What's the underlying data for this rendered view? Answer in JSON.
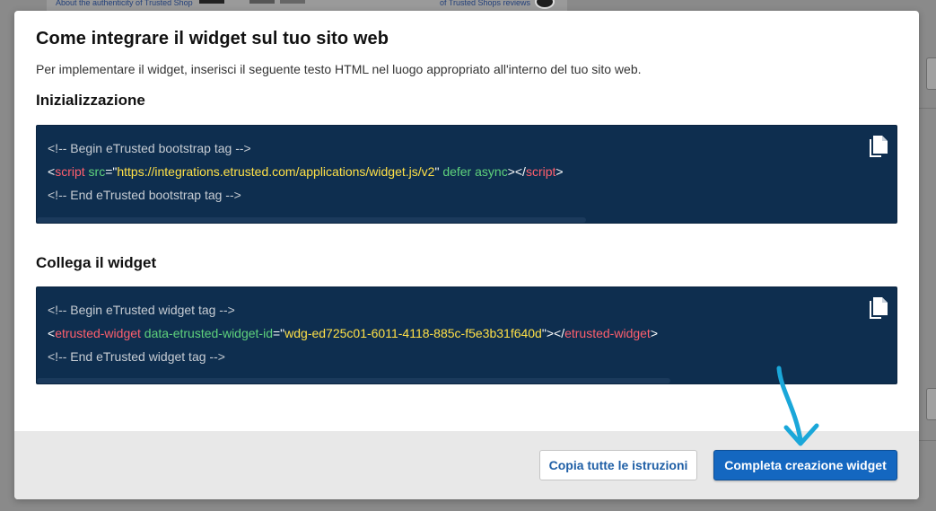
{
  "background": {
    "text_left": "About the authenticity of Trusted Shop",
    "text_right": "of Trusted Shops reviews"
  },
  "modal": {
    "title": "Come integrare il widget sul tuo sito web",
    "subtitle": "Per implementare il widget, inserisci il seguente testo HTML nel luogo appropriato all'interno del tuo sito web.",
    "sections": [
      {
        "heading": "Inizializzazione",
        "lines": {
          "comment_begin": "<!-- Begin eTrusted bootstrap tag -->",
          "lt": "<",
          "tag": "script",
          "attr1": "src",
          "eq_quote": "=\"",
          "src_value": "https://integrations.etrusted.com/applications/widget.js/v2",
          "close_quote": "\"",
          "attr2": "defer",
          "attr3": "async",
          "gt_lt_slash": "></",
          "close_tag": "script",
          "gt": ">",
          "comment_end": "<!-- End eTrusted bootstrap tag -->"
        }
      },
      {
        "heading": "Collega il widget",
        "lines": {
          "comment_begin": "<!-- Begin eTrusted widget tag -->",
          "lt": "<",
          "tag": "etrusted-widget",
          "attr1": "data-etrusted-widget-id",
          "eq_quote": "=\"",
          "id_value": "wdg-ed725c01-6011-4118-885c-f5e3b31f640d",
          "close_quote": "\"",
          "gt_lt_slash": "></",
          "close_tag": "etrusted-widget",
          "gt": ">",
          "comment_end": "<!-- End eTrusted widget tag -->"
        }
      }
    ],
    "footer": {
      "copy_all_label": "Copia tutte le istruzioni",
      "complete_label": "Completa creazione widget"
    }
  },
  "icons": {
    "copy": "copy-icon",
    "arrow": "hand-drawn-arrow-icon"
  },
  "colors": {
    "code_background": "#0e2e4f",
    "primary_button": "#1467c0",
    "arrow": "#1aa7d9"
  }
}
